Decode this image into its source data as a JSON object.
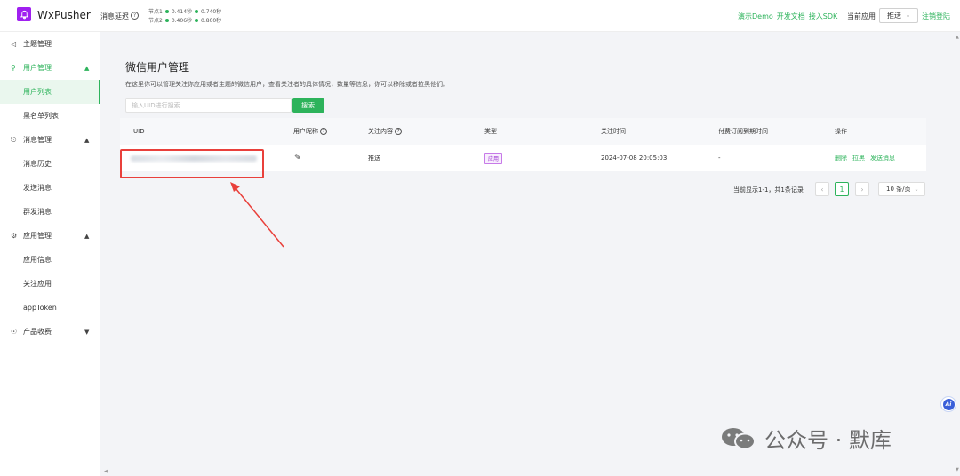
{
  "header": {
    "app_name": "WxPusher",
    "latency_label": "消息延迟",
    "nodes": [
      {
        "label": "节点1",
        "value_a": "0.414秒",
        "value_b": "0.740秒"
      },
      {
        "label": "节点2",
        "value_a": "0.406秒",
        "value_b": "0.800秒"
      }
    ],
    "links": [
      "演示Demo",
      "开发文档",
      "接入SDK"
    ],
    "current_app_label": "当前应用",
    "current_app_value": "推送",
    "logout": "注销登陆"
  },
  "sidebar": {
    "items": [
      {
        "label": "主题管理",
        "icon": "topic-icon"
      },
      {
        "label": "用户管理",
        "icon": "users-icon"
      },
      {
        "label": "用户列表"
      },
      {
        "label": "黑名单列表"
      },
      {
        "label": "消息管理",
        "icon": "bell-icon"
      },
      {
        "label": "消息历史"
      },
      {
        "label": "发送消息"
      },
      {
        "label": "群发消息"
      },
      {
        "label": "应用管理",
        "icon": "gear-icon"
      },
      {
        "label": "应用信息"
      },
      {
        "label": "关注应用"
      },
      {
        "label": "appToken"
      },
      {
        "label": "产品收费",
        "icon": "pay-icon"
      }
    ]
  },
  "main": {
    "title": "微信用户管理",
    "description": "在这里你可以管理关注你应用或者主题的微信用户，查看关注者的具体情况，数量等信息，你可以移除或者拉黑他们。",
    "search_placeholder": "输入UID进行搜索",
    "search_button": "搜索",
    "columns": [
      "UID",
      "用户昵称",
      "关注内容",
      "类型",
      "关注时间",
      "付费订阅到期时间",
      "操作"
    ],
    "rows": [
      {
        "uid": "",
        "nickname": "",
        "content": "推送",
        "type": "应用",
        "time": "2024-07-08 20:05:03",
        "expire": "-",
        "actions": [
          "删除",
          "拉黑",
          "发送消息"
        ]
      }
    ],
    "pagination": {
      "summary": "当前显示1-1，共1条记录",
      "current_page": "1",
      "page_size": "10 条/页"
    }
  },
  "watermark": "公众号 · 默库",
  "colors": {
    "accent": "#2db35b",
    "logo": "#a020f0",
    "highlight": "#e9403b"
  }
}
